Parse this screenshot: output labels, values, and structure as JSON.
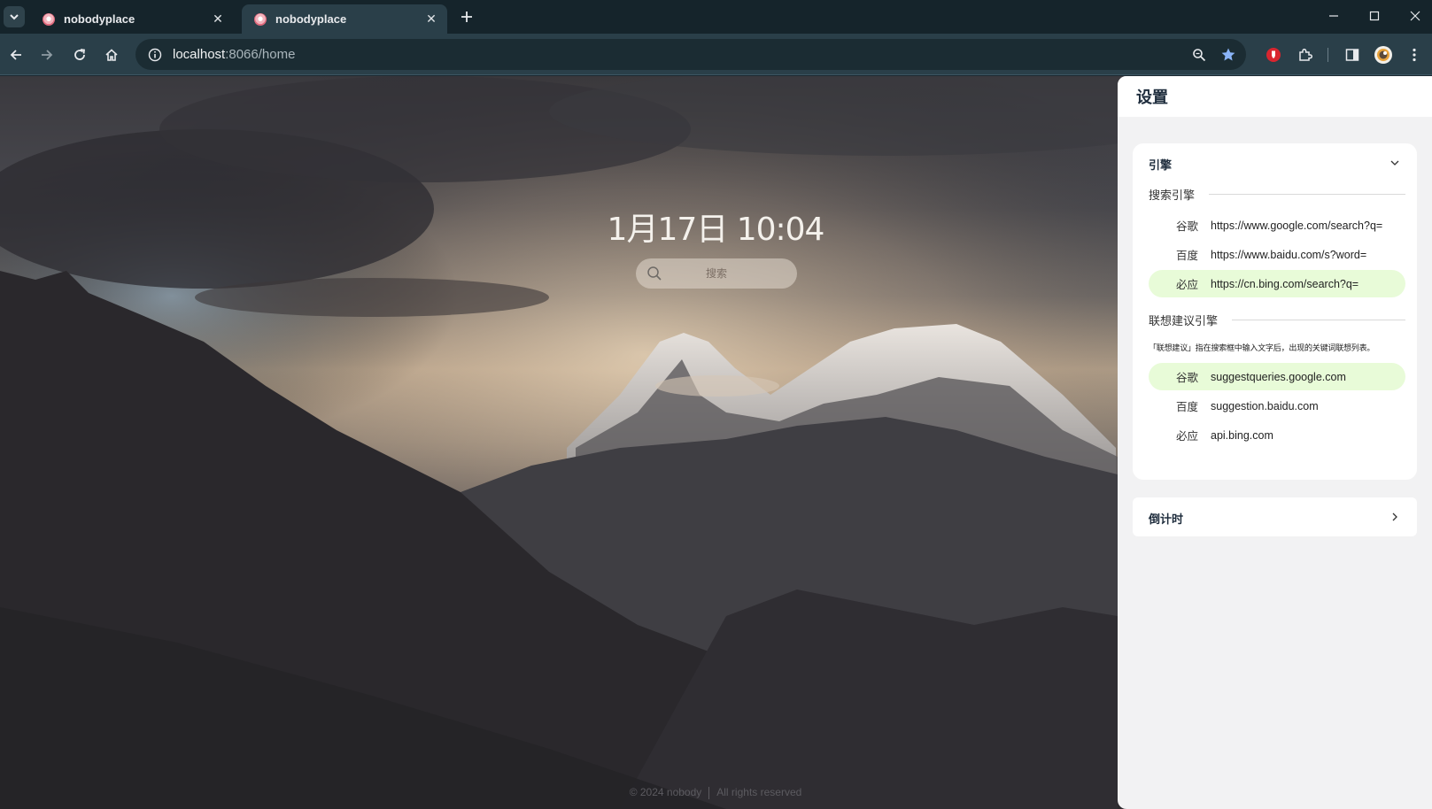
{
  "browser": {
    "tabs": [
      {
        "title": "nobodyplace",
        "active": false
      },
      {
        "title": "nobodyplace",
        "active": true
      }
    ],
    "url_host": "localhost",
    "url_path": ":8066/home",
    "icons": {
      "tab_search": "chevron-down-icon",
      "new_tab": "plus-icon",
      "minimize": "minimize-icon",
      "maximize": "maximize-icon",
      "close": "close-icon",
      "back": "arrow-left-icon",
      "forward": "arrow-right-icon",
      "reload": "reload-icon",
      "home": "home-icon",
      "site_info": "info-icon",
      "zoom": "magnifier-icon",
      "bookmark": "star-icon",
      "extension": "red-shield-icon",
      "extensions": "puzzle-icon",
      "side_panel": "side-panel-icon",
      "profile": "avatar",
      "menu": "kebab-icon"
    }
  },
  "home": {
    "clock": "1月17日 10:04",
    "search_placeholder": "搜索",
    "footer_copyright": "© 2024 nobody",
    "footer_rights": "All rights reserved"
  },
  "settings": {
    "title": "设置",
    "engine_card": {
      "title": "引擎",
      "search_section": "搜索引擎",
      "search_engines": [
        {
          "name": "谷歌",
          "url": "https://www.google.com/search?q=",
          "selected": false
        },
        {
          "name": "百度",
          "url": "https://www.baidu.com/s?word=",
          "selected": false
        },
        {
          "name": "必应",
          "url": "https://cn.bing.com/search?q=",
          "selected": true
        }
      ],
      "suggest_section": "联想建议引擎",
      "suggest_note": "「联想建议」指在搜索框中输入文字后，出现的关键词联想列表。",
      "suggest_engines": [
        {
          "name": "谷歌",
          "url": "suggestqueries.google.com",
          "selected": true
        },
        {
          "name": "百度",
          "url": "suggestion.baidu.com",
          "selected": false
        },
        {
          "name": "必应",
          "url": "api.bing.com",
          "selected": false
        }
      ]
    },
    "countdown_card": {
      "title": "倒计时"
    }
  },
  "colors": {
    "selected_row": "#e8fbd8",
    "toolbar": "#2a3f49",
    "tabstrip": "#15242b"
  }
}
